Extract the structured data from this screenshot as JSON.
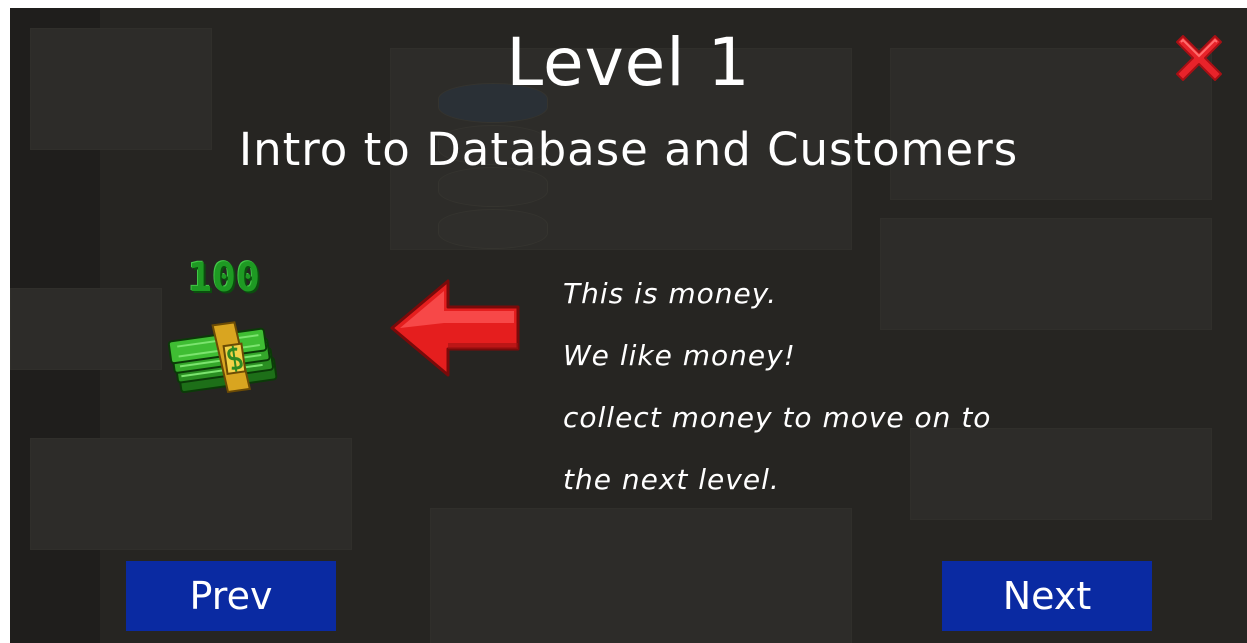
{
  "level": {
    "title": "Level 1",
    "subtitle": "Intro to Database and Customers"
  },
  "money": {
    "amount": "100",
    "icon": "cash-stack-icon"
  },
  "pointer_icon": "left-arrow-icon",
  "close_icon": "close-x-icon",
  "tutorial": {
    "lines": [
      "This is money.",
      "We like money!",
      "collect money to move on to",
      "the next level."
    ]
  },
  "navigation": {
    "prev_label": "Prev",
    "next_label": "Next"
  },
  "colors": {
    "background": "#262522",
    "button": "#0a2aa2",
    "close_red": "#e8232a",
    "arrow_red": "#e51e1e",
    "money_green": "#1e9a23",
    "text": "#ffffff"
  }
}
